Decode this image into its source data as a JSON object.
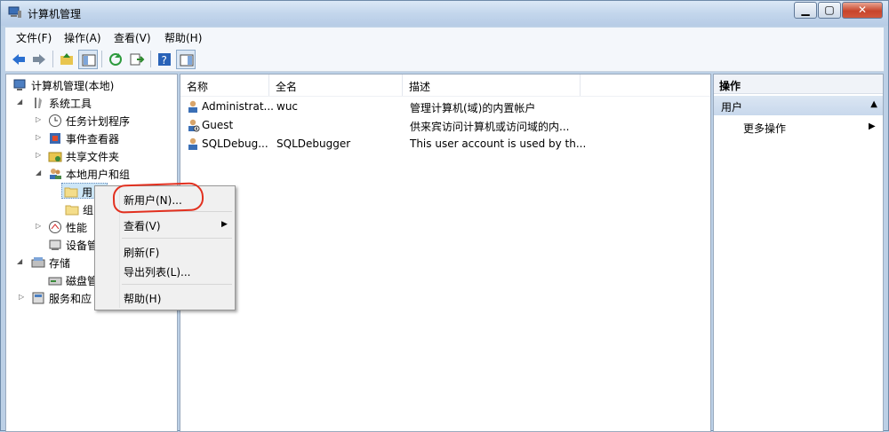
{
  "window": {
    "title": "计算机管理"
  },
  "menu": [
    "文件(F)",
    "操作(A)",
    "查看(V)",
    "帮助(H)"
  ],
  "tree": [
    {
      "label": "计算机管理(本地)",
      "icon": "computer-icon"
    },
    {
      "label": "系统工具",
      "icon": "tools-icon"
    },
    {
      "label": "任务计划程序",
      "icon": "clock-icon"
    },
    {
      "label": "事件查看器",
      "icon": "event-viewer-icon"
    },
    {
      "label": "共享文件夹",
      "icon": "shared-folder-icon"
    },
    {
      "label": "本地用户和组",
      "icon": "users-icon"
    },
    {
      "label": "用",
      "icon": "folder-icon"
    },
    {
      "label": "组",
      "icon": "folder-icon"
    },
    {
      "label": "性能",
      "icon": "performance-icon"
    },
    {
      "label": "设备管",
      "icon": "device-manager-icon"
    },
    {
      "label": "存储",
      "icon": "storage-icon"
    },
    {
      "label": "磁盘管",
      "icon": "disk-icon"
    },
    {
      "label": "服务和应",
      "icon": "services-icon"
    }
  ],
  "list": {
    "columns": [
      "名称",
      "全名",
      "描述"
    ],
    "rows": [
      {
        "name": "Administrat...",
        "fullname": "wuc",
        "desc": "管理计算机(域)的内置帐户"
      },
      {
        "name": "Guest",
        "fullname": "",
        "desc": "供来宾访问计算机或访问域的内..."
      },
      {
        "name": "SQLDebug...",
        "fullname": "SQLDebugger",
        "desc": "This user account is used by th..."
      }
    ]
  },
  "actions": {
    "title": "操作",
    "group": "用户",
    "more": "更多操作"
  },
  "context_menu": [
    "新用户(N)...",
    "查看(V)",
    "刷新(F)",
    "导出列表(L)...",
    "帮助(H)"
  ],
  "colors": {
    "titlebar": "#c3d6ec",
    "annotation": "#e2301f",
    "selection": "#cde6f7"
  }
}
